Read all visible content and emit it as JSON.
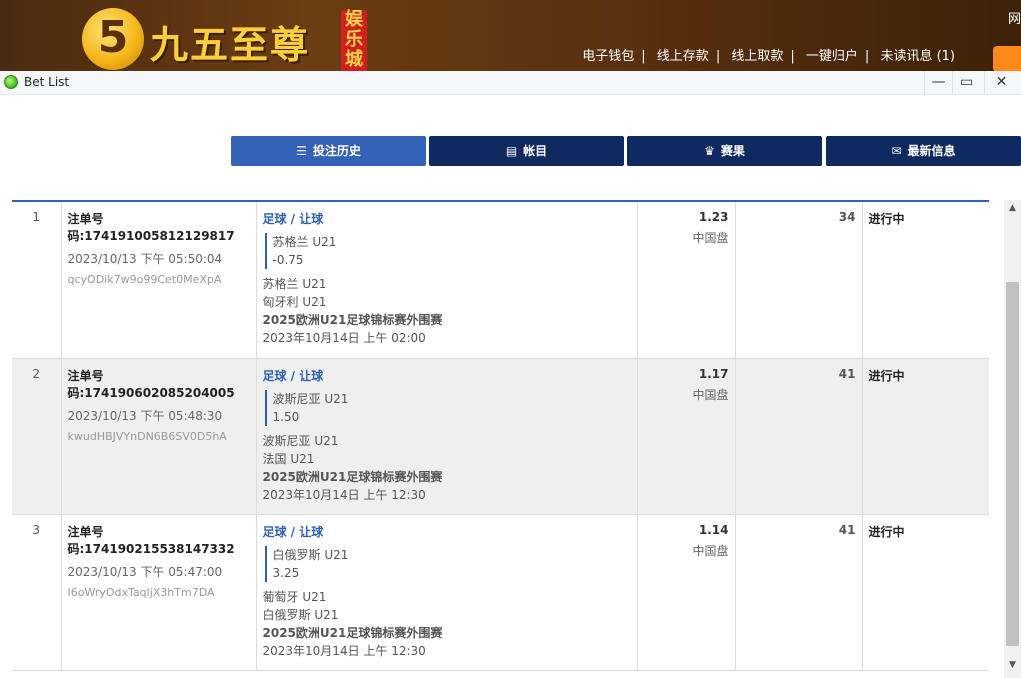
{
  "site": {
    "logo_glyph": "5",
    "logo_text": "九五至尊",
    "logo_badge": "娱乐城",
    "corner_text": "网",
    "nav": [
      "电子钱包",
      "线上存款",
      "线上取款",
      "一键归户",
      "未读讯息 (1)"
    ]
  },
  "window": {
    "title": "Bet List",
    "minimize": "—",
    "maximize": "▭",
    "close": "✕"
  },
  "tabs": [
    {
      "label": "投注历史",
      "icon": "clipboard-icon",
      "glyph": "☰"
    },
    {
      "label": "帐目",
      "icon": "ledger-icon",
      "glyph": "▤"
    },
    {
      "label": "赛果",
      "icon": "trophy-icon",
      "glyph": "♛"
    },
    {
      "label": "最新信息",
      "icon": "mail-icon",
      "glyph": "✉"
    }
  ],
  "bets": [
    {
      "index": "1",
      "bet_id": "注单号码:174191005812129817",
      "time": "2023/10/13 下午 05:50:04",
      "hash": "qcyODik7w9o99Cet0MeXpA",
      "sport": "足球 / 让球",
      "selection": "苏格兰 U21",
      "handicap": "-0.75",
      "home": "苏格兰 U21",
      "away": "匈牙利 U21",
      "league": "2025欧洲U21足球锦标赛外围赛",
      "match_time": "2023年10月14日 上午 02:00",
      "odds": "1.23",
      "market": "中国盘",
      "stake": "34",
      "status": "进行中"
    },
    {
      "index": "2",
      "bet_id": "注单号码:174190602085204005",
      "time": "2023/10/13 下午 05:48:30",
      "hash": "kwudHBJVYnDN6B6SV0D5hA",
      "sport": "足球 / 让球",
      "selection": "波斯尼亚 U21",
      "handicap": "1.50",
      "home": "波斯尼亚 U21",
      "away": "法国 U21",
      "league": "2025欧洲U21足球锦标赛外围赛",
      "match_time": "2023年10月14日 上午 12:30",
      "odds": "1.17",
      "market": "中国盘",
      "stake": "41",
      "status": "进行中"
    },
    {
      "index": "3",
      "bet_id": "注单号码:174190215538147332",
      "time": "2023/10/13 下午 05:47:00",
      "hash": "I6oWryOdxTaqljX3hTm7DA",
      "sport": "足球 / 让球",
      "selection": "白俄罗斯 U21",
      "handicap": "3.25",
      "home": "葡萄牙 U21",
      "away": "白俄罗斯 U21",
      "league": "2025欧洲U21足球锦标赛外围赛",
      "match_time": "2023年10月14日 上午 12:30",
      "odds": "1.14",
      "market": "中国盘",
      "stake": "41",
      "status": "进行中"
    }
  ],
  "colors": {
    "tab_active": "#3462b6",
    "tab_inactive": "#0f2a5e",
    "accent_link": "#2f5fb0",
    "row_alt": "#efefef"
  }
}
